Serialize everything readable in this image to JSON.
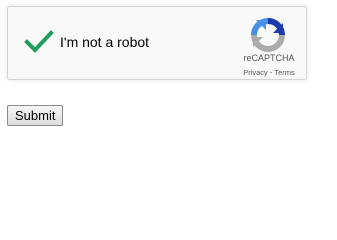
{
  "captcha": {
    "label": "I'm not a robot",
    "brand": "reCAPTCHA",
    "privacy_link": "Privacy",
    "separator": " - ",
    "terms_link": "Terms",
    "checkmark_color": "#1e9e5a",
    "logo_icon": "recaptcha-logo-icon",
    "check_icon": "checkmark-icon"
  },
  "form": {
    "submit_label": "Submit"
  }
}
